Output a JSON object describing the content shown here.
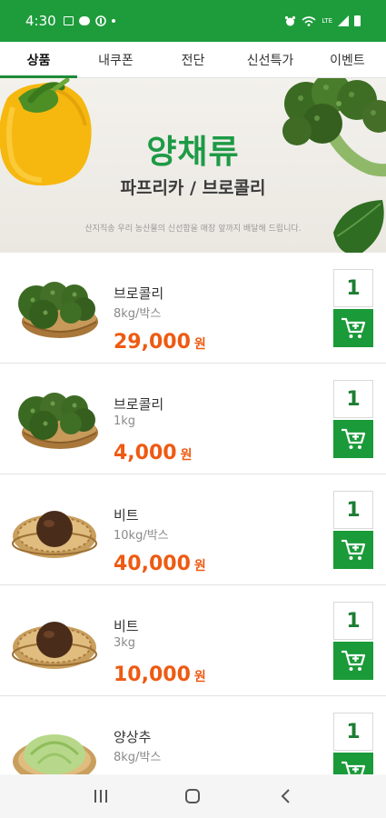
{
  "status_bar": {
    "time": "4:30",
    "lte_text": "LTE",
    "icons": [
      "gallery-icon",
      "chat-bubble-icon",
      "app-icon",
      "dot-icon",
      "alarm-icon",
      "wifi-calling-icon",
      "lte-signal-icon",
      "signal-icon",
      "battery-icon"
    ]
  },
  "tabs": [
    {
      "label": "상품",
      "active": true
    },
    {
      "label": "내쿠폰",
      "active": false
    },
    {
      "label": "전단",
      "active": false
    },
    {
      "label": "신선특가",
      "active": false
    },
    {
      "label": "이벤트",
      "active": false
    }
  ],
  "banner": {
    "title": "양채류",
    "subtitle": "파프리카 / 브로콜리",
    "note": "산지직송 우리 농산물의 신선함을 매장 앞까지 배달해 드립니다."
  },
  "products": [
    {
      "name": "브로콜리",
      "unit": "8kg/박스",
      "price": "29,000",
      "currency": "원",
      "qty": "1",
      "image": "broccoli-basket"
    },
    {
      "name": "브로콜리",
      "unit": "1kg",
      "price": "4,000",
      "currency": "원",
      "qty": "1",
      "image": "broccoli-basket"
    },
    {
      "name": "비트",
      "unit": "10kg/박스",
      "price": "40,000",
      "currency": "원",
      "qty": "1",
      "image": "beet-basket"
    },
    {
      "name": "비트",
      "unit": "3kg",
      "price": "10,000",
      "currency": "원",
      "qty": "1",
      "image": "beet-basket"
    },
    {
      "name": "양상추",
      "unit": "8kg/박스",
      "price": "",
      "currency": "",
      "qty": "1",
      "image": "lettuce-basket"
    }
  ],
  "colors": {
    "brand_green": "#1e9c3c",
    "price_orange": "#ee5a12",
    "title_green": "#1e9a46"
  },
  "nav_bar": {
    "icons": [
      "recent-apps-icon",
      "home-icon",
      "back-icon"
    ]
  }
}
